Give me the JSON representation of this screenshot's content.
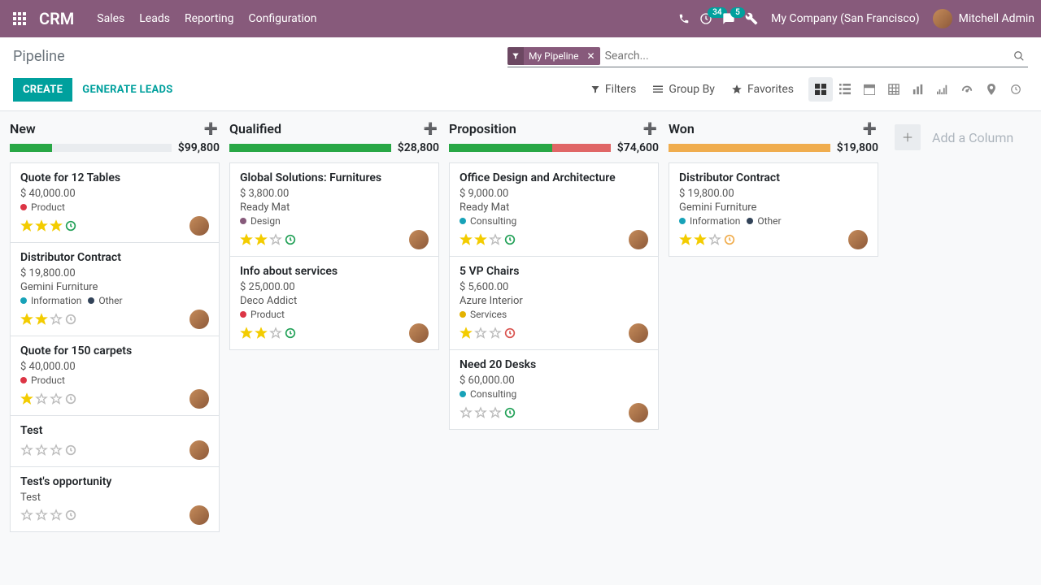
{
  "header": {
    "brand": "CRM",
    "menu": [
      "Sales",
      "Leads",
      "Reporting",
      "Configuration"
    ],
    "clock_badge": "34",
    "chat_badge": "5",
    "company": "My Company (San Francisco)",
    "user": "Mitchell Admin"
  },
  "cpanel": {
    "breadcrumb": "Pipeline",
    "facet_label": "My Pipeline",
    "search_placeholder": "Search...",
    "create": "CREATE",
    "generate": "GENERATE LEADS",
    "filters": "Filters",
    "group_by": "Group By",
    "favorites": "Favorites"
  },
  "kanban": {
    "add_column": "Add a Column",
    "columns": [
      {
        "title": "New",
        "sum": "$99,800",
        "bar": [
          {
            "w": 26,
            "c": "#28a745"
          }
        ],
        "cards": [
          {
            "title": "Quote for 12 Tables",
            "amount": "$ 40,000.00",
            "customer": "",
            "tags": [
              {
                "c": "#dc3545",
                "l": "Product"
              }
            ],
            "stars": 3,
            "act": "green"
          },
          {
            "title": "Distributor Contract",
            "amount": "$ 19,800.00",
            "customer": "Gemini Furniture",
            "tags": [
              {
                "c": "#17a2b8",
                "l": "Information"
              },
              {
                "c": "#324358",
                "l": "Other"
              }
            ],
            "stars": 2,
            "act": "grey"
          },
          {
            "title": "Quote for 150 carpets",
            "amount": "$ 40,000.00",
            "customer": "",
            "tags": [
              {
                "c": "#dc3545",
                "l": "Product"
              }
            ],
            "stars": 1,
            "act": "grey"
          },
          {
            "title": "Test",
            "amount": "",
            "customer": "",
            "tags": [],
            "stars": 0,
            "act": "grey"
          },
          {
            "title": "Test's opportunity",
            "amount": "",
            "customer": "Test",
            "tags": [],
            "stars": 0,
            "act": "grey"
          }
        ]
      },
      {
        "title": "Qualified",
        "sum": "$28,800",
        "bar": [
          {
            "w": 100,
            "c": "#28a745"
          }
        ],
        "cards": [
          {
            "title": "Global Solutions: Furnitures",
            "amount": "$ 3,800.00",
            "customer": "Ready Mat",
            "tags": [
              {
                "c": "#875a7b",
                "l": "Design"
              }
            ],
            "stars": 2,
            "act": "green"
          },
          {
            "title": "Info about services",
            "amount": "$ 25,000.00",
            "customer": "Deco Addict",
            "tags": [
              {
                "c": "#dc3545",
                "l": "Product"
              }
            ],
            "stars": 2,
            "act": "green"
          }
        ]
      },
      {
        "title": "Proposition",
        "sum": "$74,600",
        "bar": [
          {
            "w": 64,
            "c": "#28a745"
          },
          {
            "w": 36,
            "c": "#e06666"
          }
        ],
        "cards": [
          {
            "title": "Office Design and Architecture",
            "amount": "$ 9,000.00",
            "customer": "Ready Mat",
            "tags": [
              {
                "c": "#17a2b8",
                "l": "Consulting"
              }
            ],
            "stars": 2,
            "act": "green"
          },
          {
            "title": "5 VP Chairs",
            "amount": "$ 5,600.00",
            "customer": "Azure Interior",
            "tags": [
              {
                "c": "#e4b200",
                "l": "Services"
              }
            ],
            "stars": 1,
            "act": "red"
          },
          {
            "title": "Need 20 Desks",
            "amount": "$ 60,000.00",
            "customer": "",
            "tags": [
              {
                "c": "#17a2b8",
                "l": "Consulting"
              }
            ],
            "stars": 0,
            "act": "green"
          }
        ]
      },
      {
        "title": "Won",
        "sum": "$19,800",
        "bar": [
          {
            "w": 100,
            "c": "#f0ad4e"
          }
        ],
        "cards": [
          {
            "title": "Distributor Contract",
            "amount": "$ 19,800.00",
            "customer": "Gemini Furniture",
            "tags": [
              {
                "c": "#17a2b8",
                "l": "Information"
              },
              {
                "c": "#324358",
                "l": "Other"
              }
            ],
            "stars": 2,
            "act": "amber"
          }
        ]
      }
    ]
  }
}
